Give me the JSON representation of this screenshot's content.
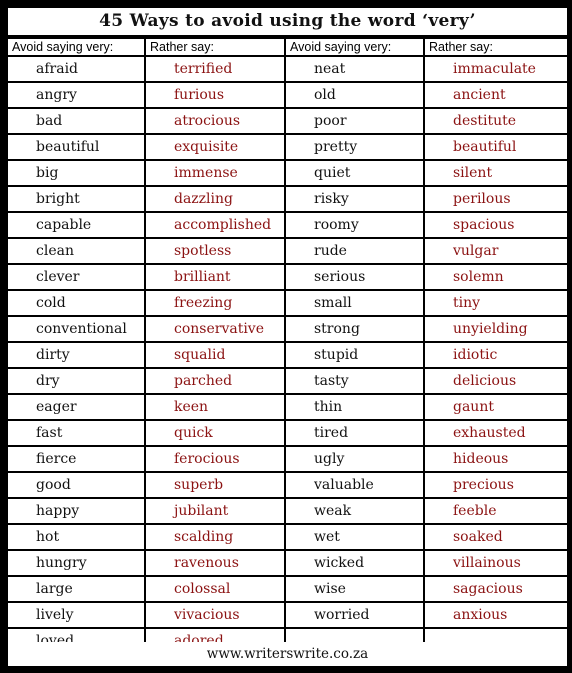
{
  "title": "45 Ways to avoid using the word ‘very’",
  "headers": [
    "Avoid saying very:",
    "Rather say:",
    "Avoid saying very:",
    "Rather say:"
  ],
  "colors": {
    "replacement_text": "#8b1212",
    "base_text": "#111111",
    "border": "#000000"
  },
  "rows": [
    {
      "avoid1": "afraid",
      "rather1": "terrified",
      "avoid2": "neat",
      "rather2": "immaculate"
    },
    {
      "avoid1": "angry",
      "rather1": "furious",
      "avoid2": "old",
      "rather2": "ancient"
    },
    {
      "avoid1": "bad",
      "rather1": "atrocious",
      "avoid2": "poor",
      "rather2": "destitute"
    },
    {
      "avoid1": "beautiful",
      "rather1": "exquisite",
      "avoid2": "pretty",
      "rather2": "beautiful"
    },
    {
      "avoid1": "big",
      "rather1": "immense",
      "avoid2": "quiet",
      "rather2": "silent"
    },
    {
      "avoid1": "bright",
      "rather1": "dazzling",
      "avoid2": "risky",
      "rather2": "perilous"
    },
    {
      "avoid1": "capable",
      "rather1": "accomplished",
      "avoid2": "roomy",
      "rather2": "spacious"
    },
    {
      "avoid1": "clean",
      "rather1": "spotless",
      "avoid2": "rude",
      "rather2": "vulgar"
    },
    {
      "avoid1": "clever",
      "rather1": "brilliant",
      "avoid2": "serious",
      "rather2": "solemn"
    },
    {
      "avoid1": "cold",
      "rather1": "freezing",
      "avoid2": "small",
      "rather2": "tiny"
    },
    {
      "avoid1": "conventional",
      "rather1": "conservative",
      "avoid2": "strong",
      "rather2": "unyielding"
    },
    {
      "avoid1": "dirty",
      "rather1": "squalid",
      "avoid2": "stupid",
      "rather2": "idiotic"
    },
    {
      "avoid1": "dry",
      "rather1": "parched",
      "avoid2": "tasty",
      "rather2": "delicious"
    },
    {
      "avoid1": "eager",
      "rather1": "keen",
      "avoid2": "thin",
      "rather2": "gaunt"
    },
    {
      "avoid1": "fast",
      "rather1": "quick",
      "avoid2": "tired",
      "rather2": "exhausted"
    },
    {
      "avoid1": "fierce",
      "rather1": "ferocious",
      "avoid2": "ugly",
      "rather2": "hideous"
    },
    {
      "avoid1": "good",
      "rather1": "superb",
      "avoid2": "valuable",
      "rather2": "precious"
    },
    {
      "avoid1": "happy",
      "rather1": "jubilant",
      "avoid2": "weak",
      "rather2": "feeble"
    },
    {
      "avoid1": "hot",
      "rather1": "scalding",
      "avoid2": "wet",
      "rather2": "soaked"
    },
    {
      "avoid1": "hungry",
      "rather1": "ravenous",
      "avoid2": "wicked",
      "rather2": "villainous"
    },
    {
      "avoid1": "large",
      "rather1": "colossal",
      "avoid2": "wise",
      "rather2": "sagacious"
    },
    {
      "avoid1": "lively",
      "rather1": "vivacious",
      "avoid2": "worried",
      "rather2": "anxious"
    },
    {
      "avoid1": "loved",
      "rather1": "adored",
      "avoid2": "",
      "rather2": ""
    }
  ],
  "footer": "www.writerswrite.co.za"
}
